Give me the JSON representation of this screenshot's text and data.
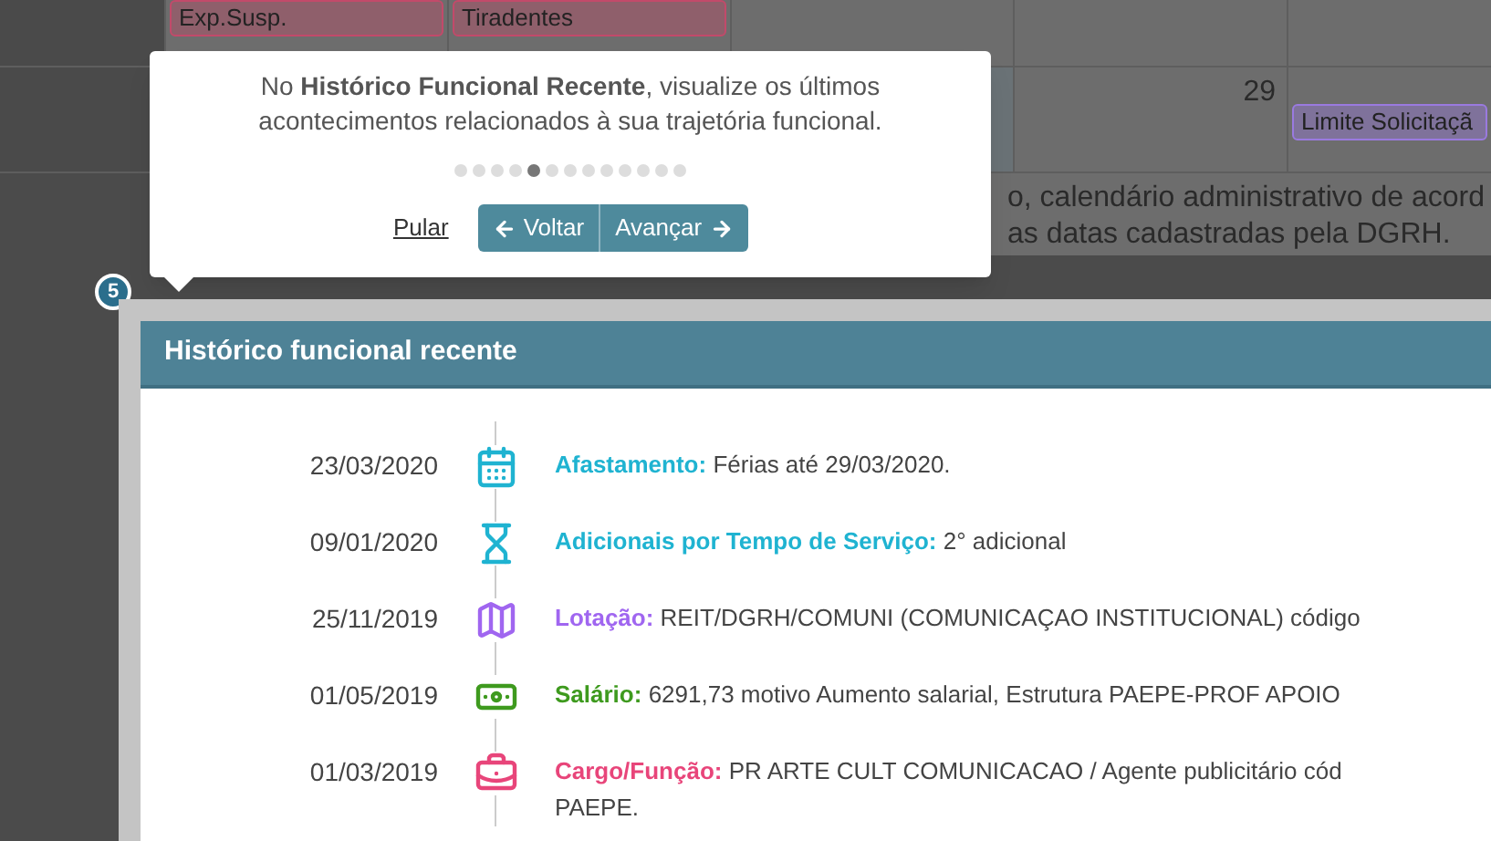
{
  "calendar": {
    "rows": [
      {
        "cells": [
          {
            "kind": "empty"
          },
          {
            "kind": "event",
            "label": "Exp.Susp.",
            "color": "#c24a6a"
          },
          {
            "kind": "event",
            "label": "Tiradentes",
            "color": "#c24a6a"
          },
          {
            "kind": "empty"
          },
          {
            "kind": "empty"
          },
          {
            "kind": "empty"
          }
        ]
      },
      {
        "cells": [
          {
            "kind": "empty"
          },
          {
            "kind": "empty"
          },
          {
            "kind": "empty"
          },
          {
            "kind": "empty"
          },
          {
            "kind": "day",
            "day": "29"
          },
          {
            "kind": "event",
            "label": "Limite Solicitaçã",
            "color": "#9a7ae0"
          }
        ]
      }
    ],
    "note_lines": [
      "o, calendário administrativo de acord",
      "as datas cadastradas pela DGRH."
    ]
  },
  "tour": {
    "step": "5",
    "text": "No **Histórico Funcional Recente**, visualize os últimos acontecimentos relacionados à sua trajetória funcional.",
    "dots": [
      {
        "selected": false
      },
      {
        "selected": false
      },
      {
        "selected": false
      },
      {
        "selected": false
      },
      {
        "selected": true
      },
      {
        "selected": false
      },
      {
        "selected": false
      },
      {
        "selected": false
      },
      {
        "selected": false
      },
      {
        "selected": false
      },
      {
        "selected": false
      },
      {
        "selected": false
      },
      {
        "selected": false
      }
    ],
    "skip": "Pular",
    "back": "Voltar",
    "next": "Avançar"
  },
  "panel": {
    "title": "Histórico funcional recente",
    "events": [
      {
        "date": "23/03/2020",
        "kind": "calendar",
        "color": "#1fb3d1",
        "label": "Afastamento:",
        "lines": [
          "Férias até 29/03/2020."
        ]
      },
      {
        "date": "09/01/2020",
        "kind": "hourglass",
        "color": "#1fb3d1",
        "label": "Adicionais por Tempo de Serviço:",
        "lines": [
          "2° adicional"
        ]
      },
      {
        "date": "25/11/2019",
        "kind": "map",
        "color": "#a066f0",
        "label": "Lotação:",
        "lines": [
          "REIT/DGRH/COMUNI (COMUNICAÇAO INSTITUCIONAL) código"
        ]
      },
      {
        "date": "01/05/2019",
        "kind": "money",
        "color": "#3e9a1e",
        "label": "Salário:",
        "lines": [
          "6291,73 motivo Aumento salarial, Estrutura PAEPE-PROF APOIO"
        ]
      },
      {
        "date": "01/03/2019",
        "kind": "briefcase",
        "color": "#e8457a",
        "label": "Cargo/Função:",
        "lines": [
          "PR ARTE CULT COMUNICACAO / Agente publicitário cód",
          "PAEPE."
        ]
      }
    ]
  }
}
